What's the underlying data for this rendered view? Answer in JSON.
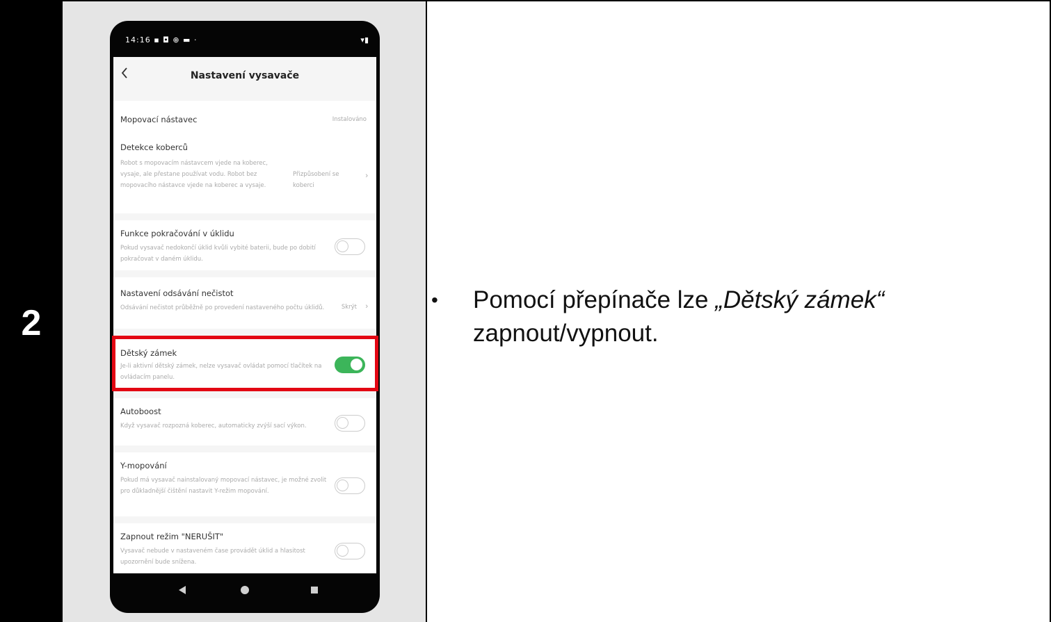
{
  "step": {
    "number": "2"
  },
  "instruction": {
    "bullet": "•",
    "prefix": "Pomocí přepínače lze ",
    "emphasis": "„Dětský zámek“",
    "suffix": "zapnout/vypnout."
  },
  "phone": {
    "status": {
      "time": "14:16 ▪ ◘ ⊕ ▬ ·",
      "icons": "▾▮"
    },
    "header": {
      "title": "Nastavení vysavače"
    },
    "rows": [
      {
        "title": "Mopovací nástavec",
        "desc": "",
        "value": "Instalováno",
        "control": "none"
      },
      {
        "title": "Detekce koberců",
        "desc": "Robot s mopovacím nástavcem vjede na koberec, vysaje, ale přestane používat vodu. Robot bez mopovacího nástavce vjede na koberec a vysaje.",
        "value": "Přizpůsobení se koberci",
        "control": "chevron"
      },
      {
        "title": "Funkce pokračování v úklidu",
        "desc": "Pokud vysavač nedokončí úklid kvůli vybité baterii, bude po dobití pokračovat v daném úklidu.",
        "value": "",
        "control": "toggle-off"
      },
      {
        "title": "Nastavení odsávání nečistot",
        "desc": "Odsávání nečistot průběžně po provedení nastaveného počtu úklidů.",
        "value": "Skrýt",
        "control": "chevron"
      },
      {
        "title": "Dětský zámek",
        "desc": "Je-li aktivní dětský zámek, nelze vysavač ovládat pomocí tlačítek na ovládacím panelu.",
        "value": "",
        "control": "toggle-on"
      },
      {
        "title": "Autoboost",
        "desc": "Když vysavač rozpozná koberec, automaticky zvýší sací výkon.",
        "value": "",
        "control": "toggle-off"
      },
      {
        "title": "Y-mopování",
        "desc": "Pokud má vysavač nainstalovaný mopovací nástavec, je možné zvolit pro důkladnější čištění nastavit Y-režim mopování.",
        "value": "",
        "control": "toggle-off"
      },
      {
        "title": "Zapnout režim \"NERUŠIT\"",
        "desc": "Vysavač nebude v nastaveném čase provádět úklid a hlasitost upozornění bude snížena.",
        "value": "",
        "control": "toggle-off"
      }
    ],
    "nav": {
      "back": "back-icon",
      "home": "home-icon",
      "recent": "recent-apps-icon"
    }
  },
  "colors": {
    "highlight": "#e30613",
    "toggle_on": "#3cb55a",
    "step_bg": "#000000"
  }
}
